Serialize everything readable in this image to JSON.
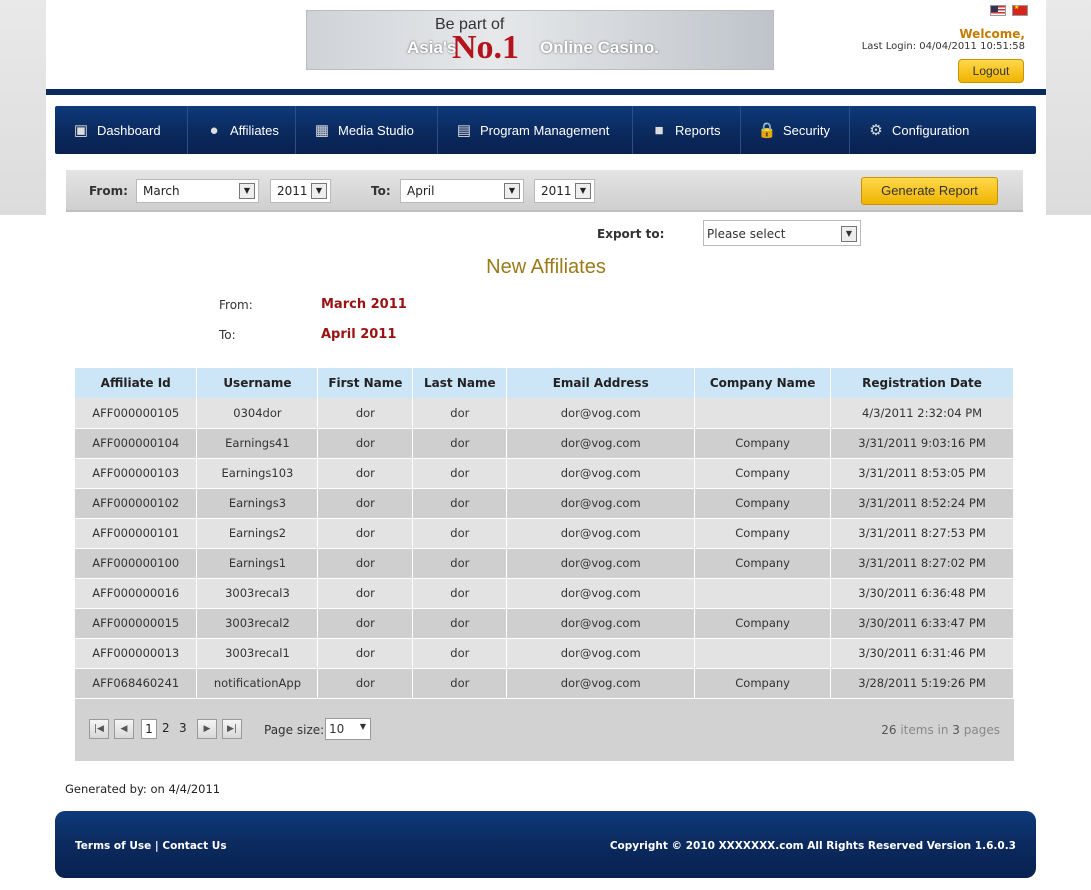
{
  "banner": {
    "line1": "Be part of",
    "line2": "Asia's",
    "no1": "No.1",
    "line3": "Online Casino."
  },
  "header": {
    "welcome": "Welcome,",
    "last_login": "Last Login: 04/04/2011 10:51:58",
    "logout_label": "Logout"
  },
  "nav": {
    "items": [
      {
        "label": "Dashboard",
        "icon": "dashboard-icon"
      },
      {
        "label": "Affiliates",
        "icon": "person-icon"
      },
      {
        "label": "Media Studio",
        "icon": "clapperboard-icon"
      },
      {
        "label": "Program Management",
        "icon": "chart-icon"
      },
      {
        "label": "Reports",
        "icon": "report-icon"
      },
      {
        "label": "Security",
        "icon": "lock-icon"
      },
      {
        "label": "Configuration",
        "icon": "gear-icon"
      }
    ]
  },
  "filter": {
    "from_label": "From:",
    "from_month": "March",
    "from_year": "2011",
    "to_label": "To:",
    "to_month": "April",
    "to_year": "2011",
    "generate_label": "Generate Report"
  },
  "export": {
    "label": "Export to:",
    "value": "Please select"
  },
  "report": {
    "title": "New Affiliates",
    "from_label": "From:",
    "from_value": "March 2011",
    "to_label": "To:",
    "to_value": "April 2011"
  },
  "table": {
    "headers": [
      "Affiliate Id",
      "Username",
      "First Name",
      "Last Name",
      "Email Address",
      "Company Name",
      "Registration Date"
    ],
    "rows": [
      [
        "AFF000000105",
        "0304dor",
        "dor",
        "dor",
        "dor@vog.com",
        "",
        "4/3/2011 2:32:04 PM"
      ],
      [
        "AFF000000104",
        "Earnings41",
        "dor",
        "dor",
        "dor@vog.com",
        "Company",
        "3/31/2011 9:03:16 PM"
      ],
      [
        "AFF000000103",
        "Earnings103",
        "dor",
        "dor",
        "dor@vog.com",
        "Company",
        "3/31/2011 8:53:05 PM"
      ],
      [
        "AFF000000102",
        "Earnings3",
        "dor",
        "dor",
        "dor@vog.com",
        "Company",
        "3/31/2011 8:52:24 PM"
      ],
      [
        "AFF000000101",
        "Earnings2",
        "dor",
        "dor",
        "dor@vog.com",
        "Company",
        "3/31/2011 8:27:53 PM"
      ],
      [
        "AFF000000100",
        "Earnings1",
        "dor",
        "dor",
        "dor@vog.com",
        "Company",
        "3/31/2011 8:27:02 PM"
      ],
      [
        "AFF000000016",
        "3003recal3",
        "dor",
        "dor",
        "dor@vog.com",
        "",
        "3/30/2011 6:36:48 PM"
      ],
      [
        "AFF000000015",
        "3003recal2",
        "dor",
        "dor",
        "dor@vog.com",
        "Company",
        "3/30/2011 6:33:47 PM"
      ],
      [
        "AFF000000013",
        "3003recal1",
        "dor",
        "dor",
        "dor@vog.com",
        "",
        "3/30/2011 6:31:46 PM"
      ],
      [
        "AFF068460241",
        "notificationApp",
        "dor",
        "dor",
        "dor@vog.com",
        "Company",
        "3/28/2011 5:19:26 PM"
      ]
    ]
  },
  "pager": {
    "pages": [
      "1",
      "2",
      "3"
    ],
    "page_size_label": "Page size:",
    "page_size": "10",
    "items_count": "26",
    "items_text": "items in",
    "pages_count": "3",
    "pages_text": "pages"
  },
  "generated_by": "Generated by:  on 4/4/2011",
  "footer": {
    "terms": "Terms of Use",
    "sep": "|",
    "contact": "Contact Us",
    "copyright": "Copyright © 2010 XXXXXXX.com All Rights Reserved  Version 1.6.0.3"
  },
  "colors": {
    "nav_bg": "#0b2a5e",
    "accent_button": "#f0b400",
    "header_row": "#cde6f7",
    "report_value": "#9b1111"
  }
}
